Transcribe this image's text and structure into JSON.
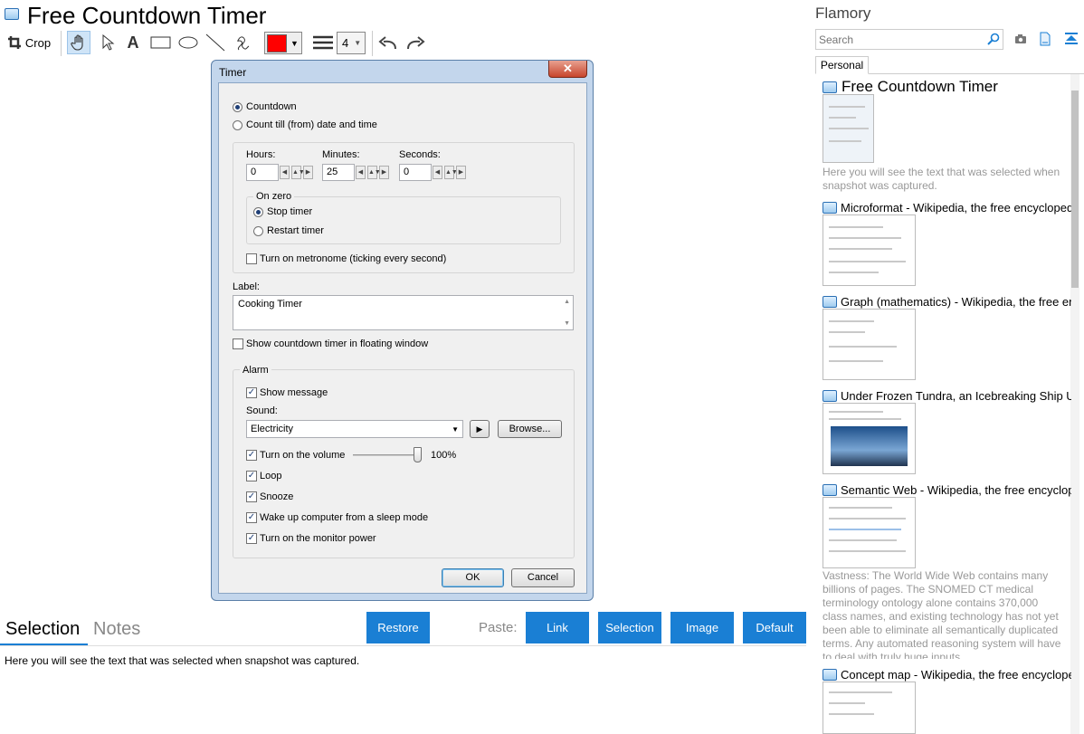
{
  "app": {
    "title": "Free Countdown Timer"
  },
  "toolbar": {
    "crop_label": "Crop",
    "text_tool": "A",
    "color": "#ff0000",
    "line_width": "4"
  },
  "dialog": {
    "title": "Timer",
    "close": "✕",
    "mode_countdown": "Countdown",
    "mode_date": "Count till (from) date and time",
    "hours_label": "Hours:",
    "hours_value": "0",
    "minutes_label": "Minutes:",
    "minutes_value": "25",
    "seconds_label": "Seconds:",
    "seconds_value": "0",
    "on_zero_label": "On zero",
    "stop_timer": "Stop timer",
    "restart_timer": "Restart timer",
    "metronome": "Turn on metronome (ticking every second)",
    "label_label": "Label:",
    "label_value": "Cooking Timer",
    "floating": "Show countdown timer in floating window",
    "alarm_label": "Alarm",
    "show_message": "Show message",
    "sound_label": "Sound:",
    "sound_value": "Electricity",
    "browse": "Browse...",
    "volume": "Turn on the volume",
    "volume_value": "100%",
    "loop": "Loop",
    "snooze": "Snooze",
    "wake_up": "Wake up computer from a sleep mode",
    "monitor": "Turn on the monitor power",
    "ok": "OK",
    "cancel": "Cancel"
  },
  "bottom": {
    "tab_selection": "Selection",
    "tab_notes": "Notes",
    "restore": "Restore",
    "paste_label": "Paste:",
    "link": "Link",
    "selection": "Selection",
    "image": "Image",
    "default": "Default",
    "selection_text": "Here you will see the text that was selected when snapshot was captured."
  },
  "sidebar": {
    "title": "Flamory",
    "search_placeholder": "Search",
    "tab_personal": "Personal",
    "cards": [
      {
        "title": "Free Countdown Timer",
        "snippet": "Here you will see the text that was selected when snapshot was captured."
      },
      {
        "title": "Microformat - Wikipedia, the free encyclopedia"
      },
      {
        "title": "Graph (mathematics) - Wikipedia, the free encyclopedia"
      },
      {
        "title": "Under Frozen Tundra, an Icebreaking Ship Uncovers"
      },
      {
        "title": "Semantic Web - Wikipedia, the free encyclopedia",
        "snippet": "Vastness: The World Wide Web contains many billions of pages. The SNOMED CT medical terminology ontology alone contains 370,000 class names, and existing technology has not yet been able to eliminate all semantically duplicated terms. Any automated reasoning system will have to deal with truly huge inputs."
      },
      {
        "title": "Concept map - Wikipedia, the free encyclopedia"
      }
    ]
  }
}
